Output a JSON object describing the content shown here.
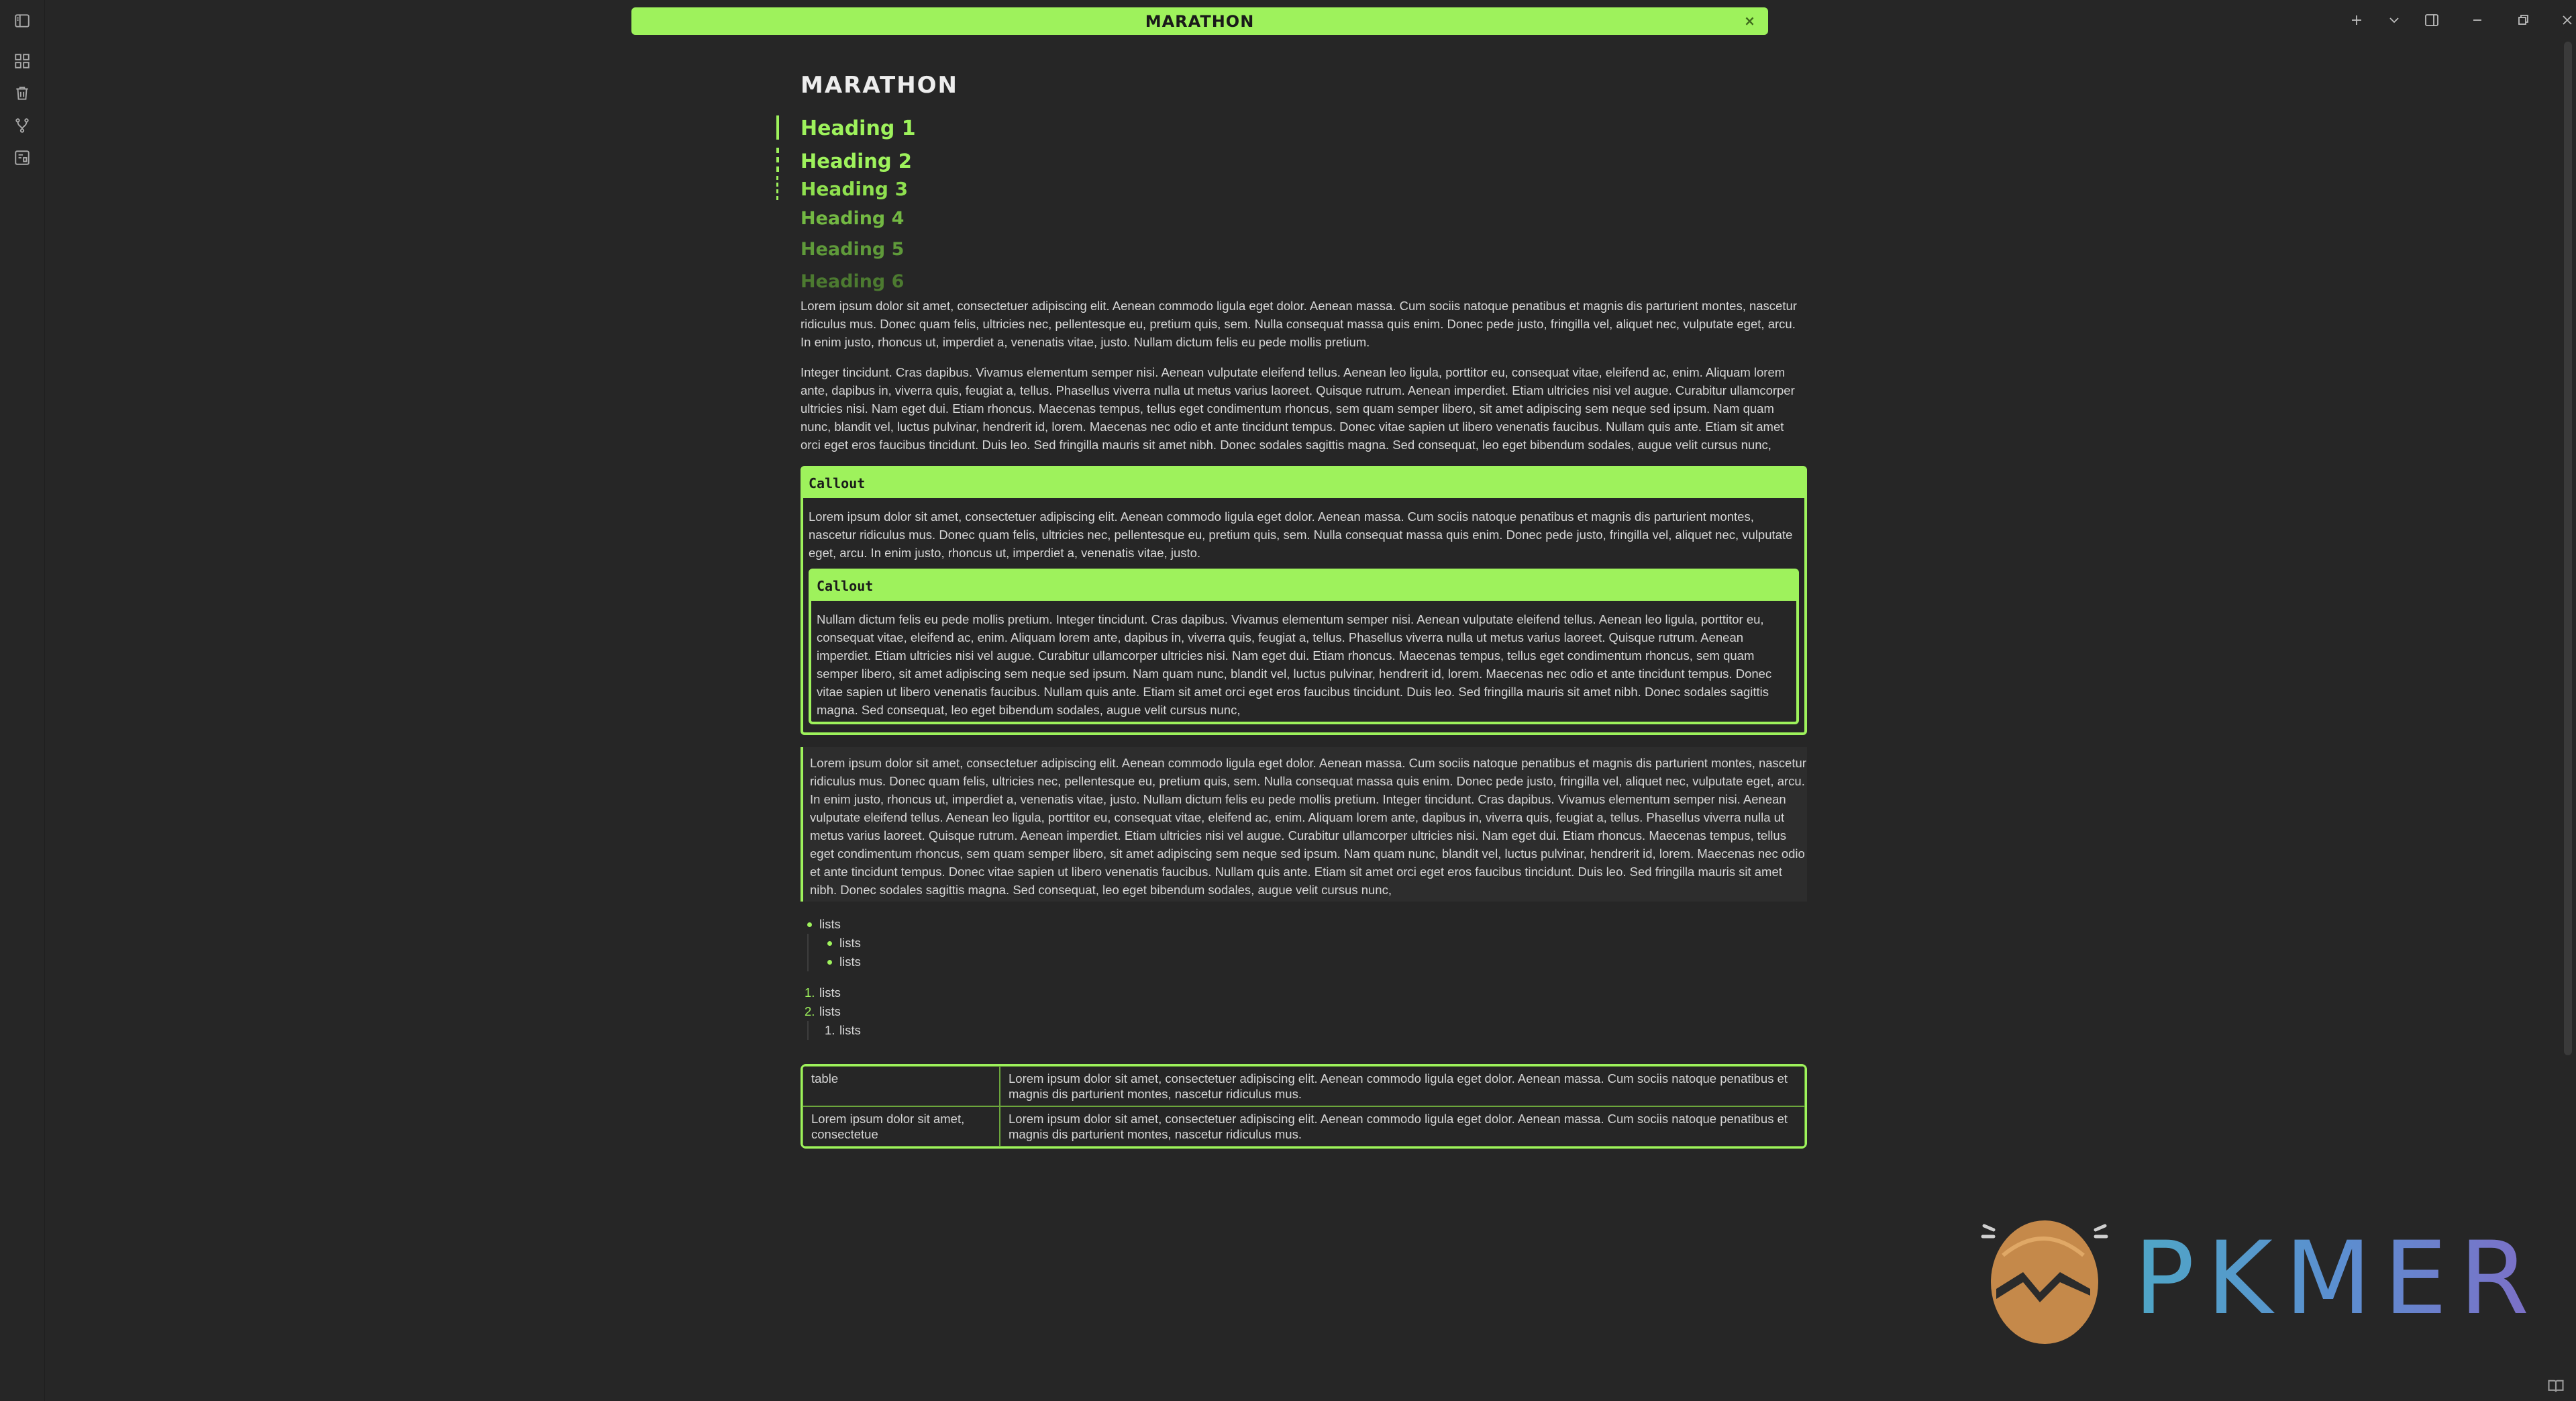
{
  "window": {
    "tab_title": "MARATHON",
    "tab_close": "×"
  },
  "document": {
    "title": "MARATHON",
    "headings": [
      "Heading 1",
      "Heading 2",
      "Heading 3",
      "Heading 4",
      "Heading 5",
      "Heading 6"
    ],
    "para1": "Lorem ipsum dolor sit amet, consectetuer adipiscing elit. Aenean commodo ligula eget dolor. Aenean massa. Cum sociis natoque penatibus et magnis dis parturient montes, nascetur ridiculus mus. Donec quam felis, ultricies nec, pellentesque eu, pretium quis, sem. Nulla consequat massa quis enim. Donec pede justo, fringilla vel, aliquet nec, vulputate eget, arcu. In enim justo, rhoncus ut, imperdiet a, venenatis vitae, justo. Nullam dictum felis eu pede mollis pretium.",
    "para2": "Integer tincidunt. Cras dapibus. Vivamus elementum semper nisi. Aenean vulputate eleifend tellus. Aenean leo ligula, porttitor eu, consequat vitae, eleifend ac, enim. Aliquam lorem ante, dapibus in, viverra quis, feugiat a, tellus. Phasellus viverra nulla ut metus varius laoreet. Quisque rutrum. Aenean imperdiet. Etiam ultricies nisi vel augue. Curabitur ullamcorper ultricies nisi. Nam eget dui. Etiam rhoncus. Maecenas tempus, tellus eget condimentum rhoncus, sem quam semper libero, sit amet adipiscing sem neque sed ipsum. Nam quam nunc, blandit vel, luctus pulvinar, hendrerit id, lorem. Maecenas nec odio et ante tincidunt tempus. Donec vitae sapien ut libero venenatis faucibus. Nullam quis ante. Etiam sit amet orci eget eros faucibus tincidunt. Duis leo. Sed fringilla mauris sit amet nibh. Donec sodales sagittis magna. Sed consequat, leo eget bibendum sodales, augue velit cursus nunc,",
    "callout": {
      "title": "Callout",
      "body": "Lorem ipsum dolor sit amet, consectetuer adipiscing elit. Aenean commodo ligula eget dolor. Aenean massa. Cum sociis natoque penatibus et magnis dis parturient montes, nascetur ridiculus mus. Donec quam felis, ultricies nec, pellentesque eu, pretium quis, sem. Nulla consequat massa quis enim. Donec pede justo, fringilla vel, aliquet nec, vulputate eget, arcu. In enim justo, rhoncus ut, imperdiet a, venenatis vitae, justo.",
      "inner_title": "Callout",
      "inner_body": "Nullam dictum felis eu pede mollis pretium. Integer tincidunt. Cras dapibus. Vivamus elementum semper nisi. Aenean vulputate eleifend tellus. Aenean leo ligula, porttitor eu, consequat vitae, eleifend ac, enim. Aliquam lorem ante, dapibus in, viverra quis, feugiat a, tellus. Phasellus viverra nulla ut metus varius laoreet. Quisque rutrum. Aenean imperdiet. Etiam ultricies nisi vel augue. Curabitur ullamcorper ultricies nisi. Nam eget dui. Etiam rhoncus. Maecenas tempus, tellus eget condimentum rhoncus, sem quam semper libero, sit amet adipiscing sem neque sed ipsum. Nam quam nunc, blandit vel, luctus pulvinar, hendrerit id, lorem. Maecenas nec odio et ante tincidunt tempus. Donec vitae sapien ut libero venenatis faucibus. Nullam quis ante. Etiam sit amet orci eget eros faucibus tincidunt. Duis leo. Sed fringilla mauris sit amet nibh. Donec sodales sagittis magna. Sed consequat, leo eget bibendum sodales, augue velit cursus nunc,"
    },
    "quote": "Lorem ipsum dolor sit amet, consectetuer adipiscing elit. Aenean commodo ligula eget dolor. Aenean massa. Cum sociis natoque penatibus et magnis dis parturient montes, nascetur ridiculus mus. Donec quam felis, ultricies nec, pellentesque eu, pretium quis, sem. Nulla consequat massa quis enim. Donec pede justo, fringilla vel, aliquet nec, vulputate eget, arcu. In enim justo, rhoncus ut, imperdiet a, venenatis vitae, justo. Nullam dictum felis eu pede mollis pretium. Integer tincidunt. Cras dapibus. Vivamus elementum semper nisi. Aenean vulputate eleifend tellus. Aenean leo ligula, porttitor eu, consequat vitae, eleifend ac, enim. Aliquam lorem ante, dapibus in, viverra quis, feugiat a, tellus. Phasellus viverra nulla ut metus varius laoreet. Quisque rutrum. Aenean imperdiet. Etiam ultricies nisi vel augue. Curabitur ullamcorper ultricies nisi. Nam eget dui. Etiam rhoncus. Maecenas tempus, tellus eget condimentum rhoncus, sem quam semper libero, sit amet adipiscing sem neque sed ipsum. Nam quam nunc, blandit vel, luctus pulvinar, hendrerit id, lorem. Maecenas nec odio et ante tincidunt tempus. Donec vitae sapien ut libero venenatis faucibus. Nullam quis ante. Etiam sit amet orci eget eros faucibus tincidunt. Duis leo. Sed fringilla mauris sit amet nibh. Donec sodales sagittis magna. Sed consequat, leo eget bibendum sodales, augue velit cursus nunc,",
    "bullet_list": {
      "item": "lists",
      "children": [
        "lists",
        "lists"
      ]
    },
    "ordered_list": {
      "items": [
        {
          "num": "1.",
          "text": "lists"
        },
        {
          "num": "2.",
          "text": "lists"
        }
      ],
      "child": {
        "num": "1.",
        "text": "lists"
      }
    },
    "table": {
      "rows": [
        [
          "table",
          "Lorem ipsum dolor sit amet, consectetuer adipiscing elit. Aenean commodo ligula eget dolor. Aenean massa. Cum sociis natoque penatibus et magnis dis parturient montes, nascetur ridiculus mus."
        ],
        [
          "Lorem ipsum dolor sit amet, consectetue",
          "Lorem ipsum dolor sit amet, consectetuer adipiscing elit. Aenean commodo ligula eget dolor. Aenean massa. Cum sociis natoque penatibus et magnis dis parturient montes, nascetur ridiculus mus."
        ]
      ]
    }
  },
  "watermark": {
    "text": "PKMER"
  },
  "colors": {
    "accent": "#9ef25c",
    "background": "#262626"
  },
  "icons": {
    "ribbon": [
      "sidebar-toggle-icon",
      "dashboard-icon",
      "trash-icon",
      "graph-icon",
      "canvas-icon"
    ],
    "titlebar": [
      "plus-icon",
      "chevron-down-icon",
      "split-view-icon",
      "minimize-icon",
      "restore-icon",
      "close-icon"
    ]
  }
}
